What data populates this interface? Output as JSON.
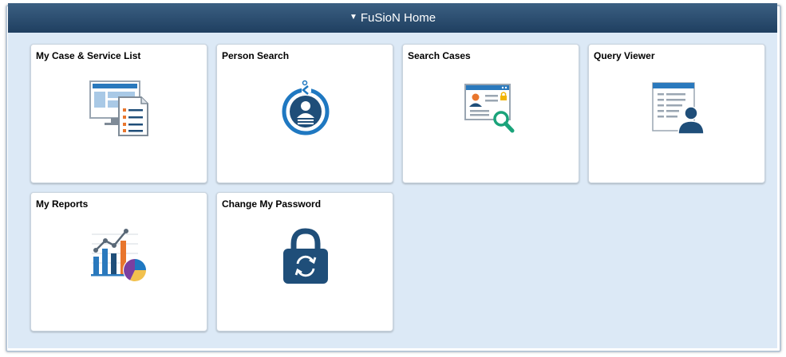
{
  "header": {
    "caret": "▼",
    "title": "FuSioN Home"
  },
  "tiles": [
    {
      "label": "My Case & Service List",
      "icon": "case-service-list-icon"
    },
    {
      "label": "Person Search",
      "icon": "person-search-icon"
    },
    {
      "label": "Search Cases",
      "icon": "search-cases-icon"
    },
    {
      "label": "Query Viewer",
      "icon": "query-viewer-icon"
    },
    {
      "label": "My Reports",
      "icon": "reports-chart-icon"
    },
    {
      "label": "Change My Password",
      "icon": "password-lock-icon"
    }
  ],
  "colors": {
    "header_top": "#3b5f82",
    "header_bottom": "#1f3f60",
    "panel_background": "#dce9f6",
    "icon_blue": "#1f78c1",
    "icon_navy": "#1f4e79",
    "icon_orange": "#e8762d",
    "icon_teal": "#1aa37a",
    "icon_purple": "#7b3fa0"
  }
}
